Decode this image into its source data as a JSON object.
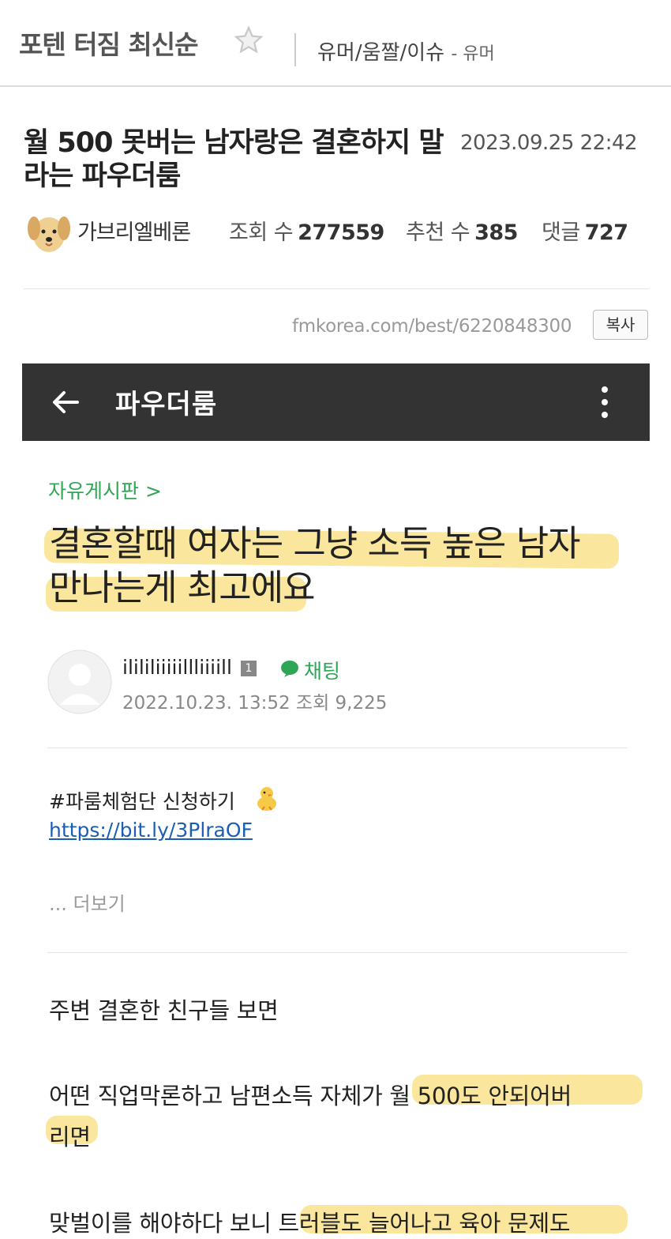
{
  "header": {
    "board_title": "포텐 터짐 최신순",
    "category": "유머/움짤/이슈",
    "subcategory": "- 유머"
  },
  "post": {
    "title": "월 500 못버는 남자랑은 결혼하지 말라는 파우더룸",
    "date": "2023.09.25 22:42",
    "author": "가브리엘베론",
    "views_label": "조회 수",
    "views": "277559",
    "likes_label": "추천 수",
    "likes": "385",
    "comments_label": "댓글",
    "comments": "727",
    "url": "fmkorea.com/best/6220848300",
    "copy_label": "복사"
  },
  "screenshot": {
    "app_title": "파우더룸",
    "board_link": "자유게시판 >",
    "title_line1": "결혼할때 여자는 그냥 소득 높은 남자",
    "title_line2": "만나는게 최고에요",
    "nickname": "ilililiiiiillliiiill",
    "level": "1",
    "chat_label": "채팅",
    "meta": "2022.10.23. 13:52 조회 9,225",
    "tag_text": "#파룸체험단 신청하기",
    "link": "https://bit.ly/3PlraOF",
    "more": "... 더보기",
    "body": [
      "주변 결혼한 친구들 보면",
      "어떤 직업막론하고 남편소득 자체가 월 500도 안되어버",
      "리면",
      "맞벌이를 해야하다 보니 트러블도 늘어나고 육아 문제도"
    ]
  },
  "colors": {
    "highlight": "#f8df7c",
    "green": "#2ea655",
    "appbar": "#333333",
    "link": "#1a5fb4"
  }
}
